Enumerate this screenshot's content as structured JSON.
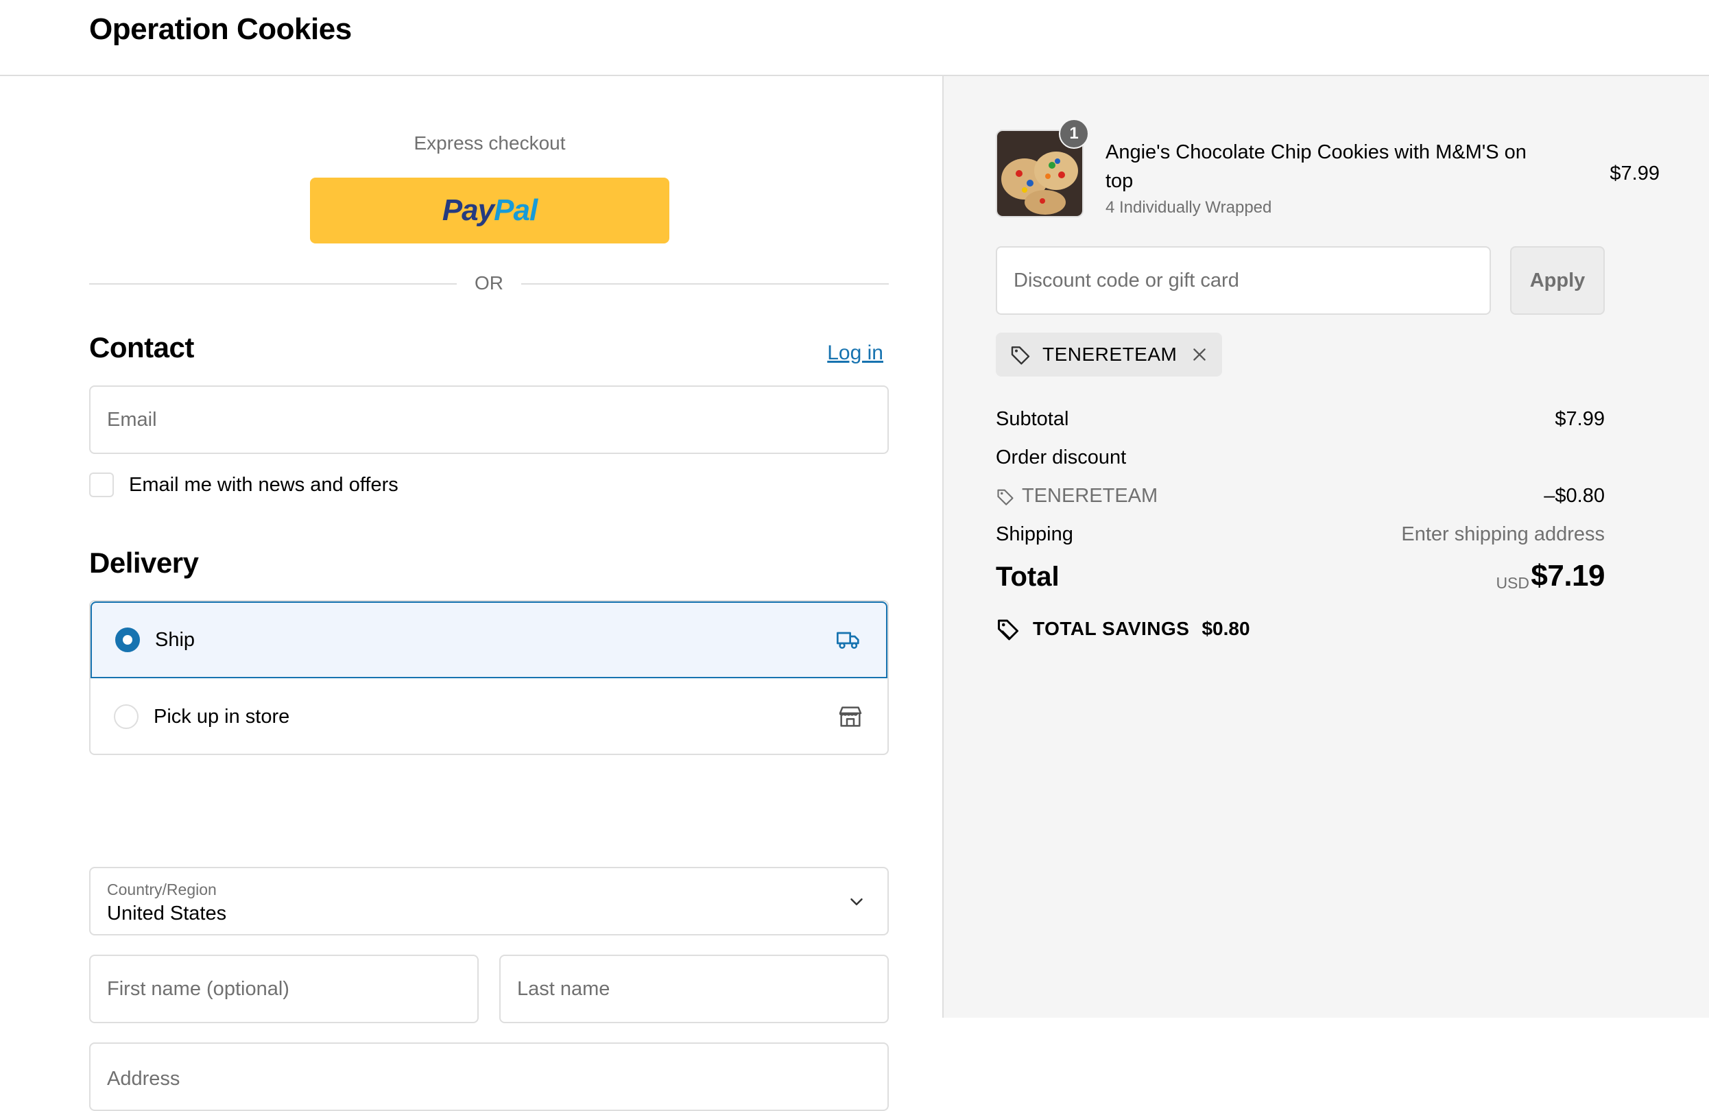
{
  "header": {
    "shop_title": "Operation Cookies"
  },
  "express": {
    "label": "Express checkout",
    "paypal": {
      "pay": "Pay",
      "pal": "Pal"
    },
    "divider": "OR"
  },
  "contact": {
    "title": "Contact",
    "login": "Log in",
    "email_placeholder": "Email",
    "news_label": "Email me with news and offers"
  },
  "delivery": {
    "title": "Delivery",
    "options": [
      {
        "label": "Ship",
        "selected": true,
        "icon": "truck-icon"
      },
      {
        "label": "Pick up in store",
        "selected": false,
        "icon": "store-icon"
      }
    ],
    "country": {
      "label": "Country/Region",
      "value": "United States"
    },
    "first_name_placeholder": "First name (optional)",
    "last_name_placeholder": "Last name",
    "address_placeholder": "Address"
  },
  "cart": {
    "item": {
      "quantity": "1",
      "name": "Angie's Chocolate Chip Cookies with M&M'S on top",
      "variant": "4 Individually Wrapped",
      "price": "$7.99"
    },
    "discount_placeholder": "Discount code or gift card",
    "apply": "Apply",
    "applied_code": "TENERETEAM",
    "summary": {
      "subtotal_label": "Subtotal",
      "subtotal": "$7.99",
      "order_discount_label": "Order discount",
      "code_label": "TENERETEAM",
      "code_amount": "–$0.80",
      "shipping_label": "Shipping",
      "shipping_value": "Enter shipping address",
      "total_label": "Total",
      "currency": "USD",
      "total": "$7.19",
      "savings_label": "TOTAL SAVINGS",
      "savings": "$0.80"
    }
  },
  "colors": {
    "accent": "#1773b0",
    "paypal_yellow": "#ffc439",
    "panel": "#f5f5f5"
  }
}
